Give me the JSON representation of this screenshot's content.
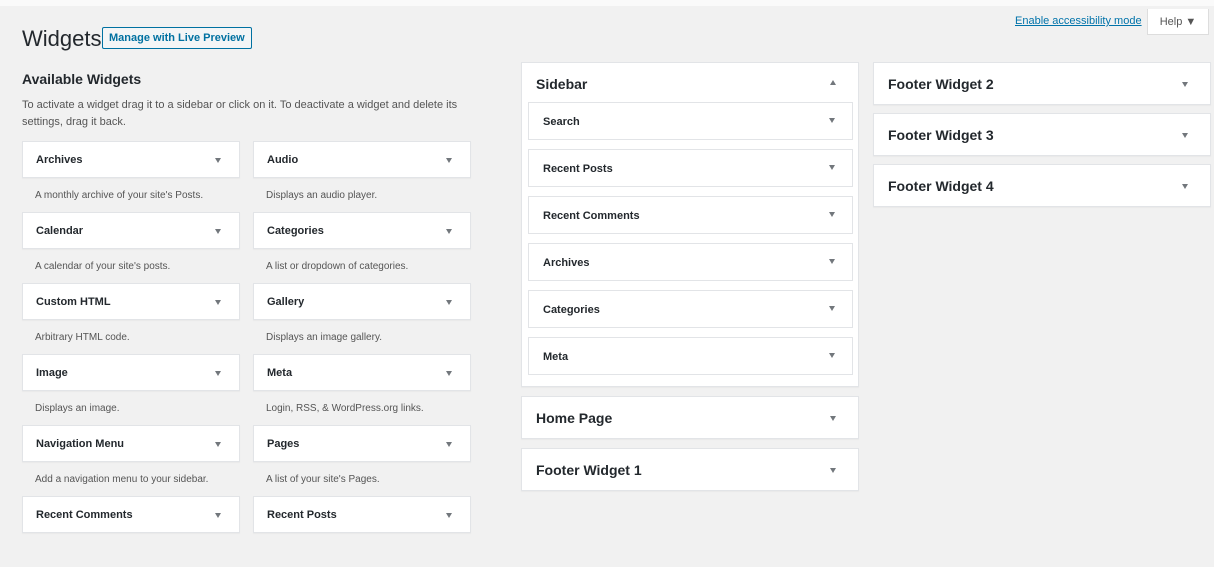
{
  "header": {
    "title": "Widgets",
    "live_preview_label": "Manage with Live Preview",
    "accessibility_link": "Enable accessibility mode",
    "help_label": "Help ▼"
  },
  "available": {
    "title": "Available Widgets",
    "description": "To activate a widget drag it to a sidebar or click on it. To deactivate a widget and delete its settings, drag it back.",
    "left": [
      {
        "title": "Archives",
        "desc": "A monthly archive of your site's Posts."
      },
      {
        "title": "Calendar",
        "desc": "A calendar of your site's posts."
      },
      {
        "title": "Custom HTML",
        "desc": "Arbitrary HTML code."
      },
      {
        "title": "Image",
        "desc": "Displays an image."
      },
      {
        "title": "Navigation Menu",
        "desc": "Add a navigation menu to your sidebar."
      },
      {
        "title": "Recent Comments",
        "desc": ""
      }
    ],
    "right": [
      {
        "title": "Audio",
        "desc": "Displays an audio player."
      },
      {
        "title": "Categories",
        "desc": "A list or dropdown of categories."
      },
      {
        "title": "Gallery",
        "desc": "Displays an image gallery."
      },
      {
        "title": "Meta",
        "desc": "Login, RSS, & WordPress.org links."
      },
      {
        "title": "Pages",
        "desc": "A list of your site's Pages."
      },
      {
        "title": "Recent Posts",
        "desc": ""
      }
    ]
  },
  "sidebar": {
    "title": "Sidebar",
    "widgets": [
      "Search",
      "Recent Posts",
      "Recent Comments",
      "Archives",
      "Categories",
      "Meta"
    ]
  },
  "areas": {
    "home_page": "Home Page",
    "footer_1": "Footer Widget 1",
    "footer_2": "Footer Widget 2",
    "footer_3": "Footer Widget 3",
    "footer_4": "Footer Widget 4"
  },
  "colors": {
    "accent": "#0071a1",
    "link": "#0073aa",
    "background": "#f1f1f1"
  }
}
